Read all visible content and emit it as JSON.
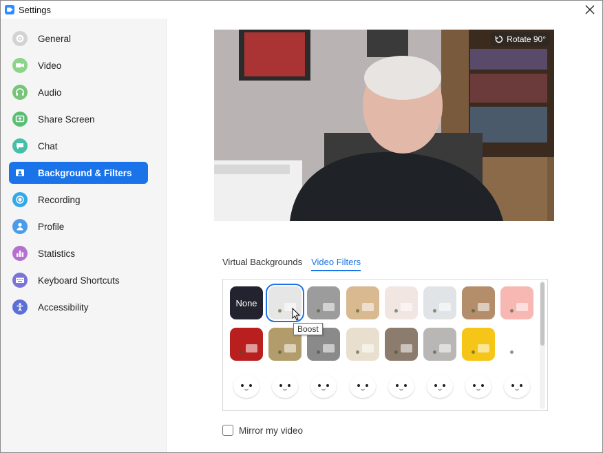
{
  "window": {
    "title": "Settings"
  },
  "sidebar": {
    "items": [
      {
        "label": "General",
        "icon": "gear-icon",
        "color": "#d3d3d3"
      },
      {
        "label": "Video",
        "icon": "video-camera-icon",
        "color": "#8bd48a"
      },
      {
        "label": "Audio",
        "icon": "headphones-icon",
        "color": "#78c47b"
      },
      {
        "label": "Share Screen",
        "icon": "share-screen-icon",
        "color": "#5bbd73"
      },
      {
        "label": "Chat",
        "icon": "chat-bubble-icon",
        "color": "#46bfa8"
      },
      {
        "label": "Background & Filters",
        "icon": "background-person-icon",
        "color": "#1a73e8"
      },
      {
        "label": "Recording",
        "icon": "record-icon",
        "color": "#35a8e8"
      },
      {
        "label": "Profile",
        "icon": "person-icon",
        "color": "#4a9be8"
      },
      {
        "label": "Statistics",
        "icon": "bar-chart-icon",
        "color": "#b56fd0"
      },
      {
        "label": "Keyboard Shortcuts",
        "icon": "keyboard-icon",
        "color": "#7b73d6"
      },
      {
        "label": "Accessibility",
        "icon": "accessibility-icon",
        "color": "#5b6fd6"
      }
    ],
    "active_index": 5
  },
  "video": {
    "rotate_label": "Rotate 90°"
  },
  "tabs": [
    {
      "label": "Virtual Backgrounds",
      "active": false
    },
    {
      "label": "Video Filters",
      "active": true
    }
  ],
  "filters": {
    "none_label": "None",
    "selected_tooltip": "Boost",
    "rows": [
      [
        "#23232f",
        "#e6e6e6",
        "#9c9c9c",
        "#d9b98f",
        "#f2e6e3",
        "#e1e4e6",
        "#b48e6b",
        "#f7b7b3"
      ],
      [
        "#b91f1f",
        "#b39c6c",
        "#8a8a8a",
        "#e9dfcf",
        "#8b7c6d",
        "#b9b7b5",
        "#f5c518",
        "#ffffff"
      ],
      [
        "#ffffff",
        "#ffffff",
        "#ffffff",
        "#ffffff",
        "#ffffff",
        "#ffffff",
        "#ffffff",
        "#ffffff"
      ]
    ]
  },
  "mirror": {
    "label": "Mirror my video",
    "checked": false
  },
  "colors": {
    "accent": "#1a73e8"
  }
}
